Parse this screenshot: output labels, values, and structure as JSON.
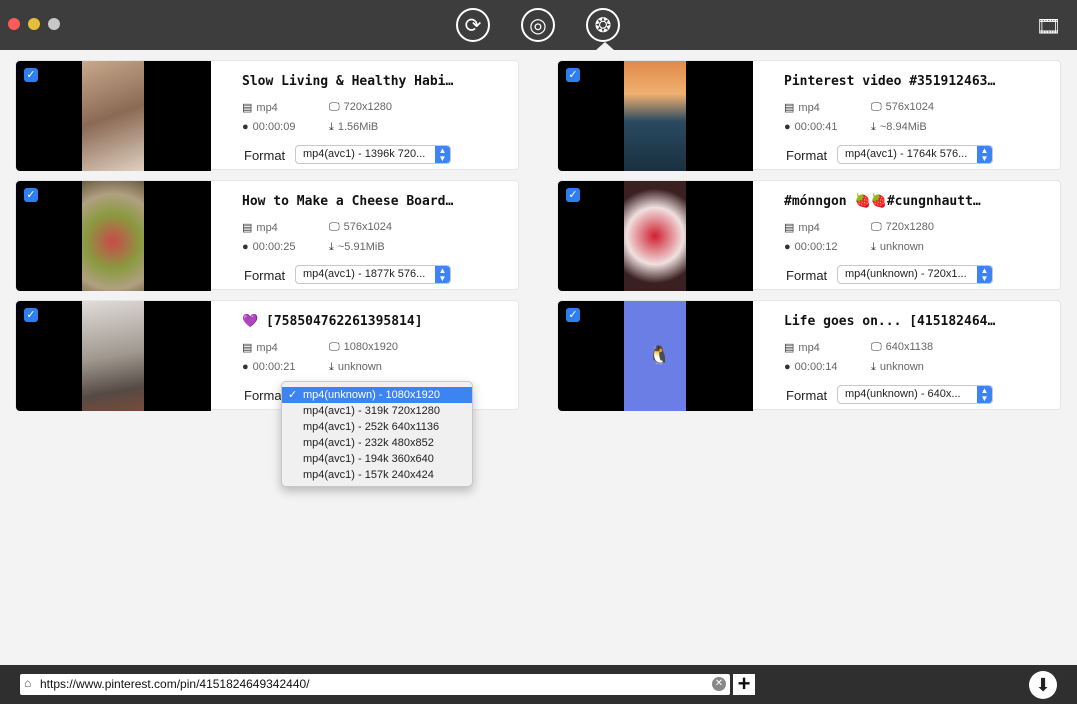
{
  "toolbar": {
    "icons": [
      "convert-icon",
      "record-icon",
      "download-video-icon",
      "media-library-icon"
    ],
    "active": "download-video-icon"
  },
  "colors": {
    "accent": "#3b84f2",
    "titlebar": "#3d3d3d",
    "close": "#fc5b57",
    "minimize": "#e5bf3c",
    "zoom": "#c8c8c8"
  },
  "labels": {
    "format": "Format"
  },
  "videos": [
    {
      "title": "Slow Living & Healthy Habi…",
      "container": "mp4",
      "resolution": "720x1280",
      "duration": "00:00:09",
      "size": "1.56MiB",
      "format": "mp4(avc1) - 1396k 720...",
      "checked": true
    },
    {
      "title": "Pinterest video #351912463…",
      "container": "mp4",
      "resolution": "576x1024",
      "duration": "00:00:41",
      "size": "~8.94MiB",
      "format": "mp4(avc1) - 1764k 576...",
      "checked": true
    },
    {
      "title": "How to Make a Cheese Board…",
      "container": "mp4",
      "resolution": "576x1024",
      "duration": "00:00:25",
      "size": "~5.91MiB",
      "format": "mp4(avc1) - 1877k 576...",
      "checked": true
    },
    {
      "title": "#mónngon 🍓🍓#cungnhautt…",
      "container": "mp4",
      "resolution": "720x1280",
      "duration": "00:00:12",
      "size": "unknown",
      "format": "mp4(unknown) -  720x1...",
      "checked": true
    },
    {
      "title": "💜 [758504762261395814]",
      "container": "mp4",
      "resolution": "1080x1920",
      "duration": "00:00:21",
      "size": "unknown",
      "format": "mp4(unknown) -  1080x1920",
      "checked": true
    },
    {
      "title": "Life goes on... [415182464…",
      "container": "mp4",
      "resolution": "640x1138",
      "duration": "00:00:14",
      "size": "unknown",
      "format": "mp4(unknown) -  640x...",
      "checked": true
    }
  ],
  "dropdown": {
    "options": [
      "mp4(unknown) -  1080x1920",
      "mp4(avc1) - 319k 720x1280",
      "mp4(avc1) - 252k 640x1136",
      "mp4(avc1) - 232k 480x852",
      "mp4(avc1) - 194k 360x640",
      "mp4(avc1) - 157k 240x424"
    ],
    "selected": 0
  },
  "url": {
    "value": "https://www.pinterest.com/pin/4151824649342440/"
  }
}
